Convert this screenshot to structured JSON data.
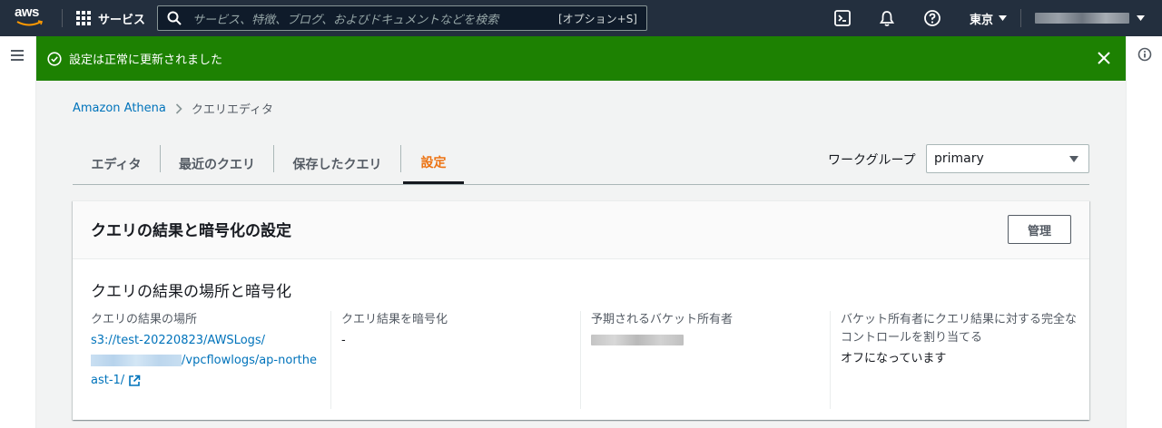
{
  "nav": {
    "logo_text": "aws",
    "services_label": "サービス",
    "search_placeholder": "サービス、特徴、ブログ、およびドキュメントなどを検索",
    "search_shortcut": "[オプション+S]",
    "region_label": "東京"
  },
  "flash": {
    "message": "設定は正常に更新されました"
  },
  "breadcrumb": {
    "root": "Amazon Athena",
    "current": "クエリエディタ"
  },
  "tabs": [
    {
      "label": "エディタ"
    },
    {
      "label": "最近のクエリ"
    },
    {
      "label": "保存したクエリ"
    },
    {
      "label": "設定"
    }
  ],
  "workgroup": {
    "label": "ワークグループ",
    "value": "primary"
  },
  "panel": {
    "title": "クエリの結果と暗号化の設定",
    "manage_label": "管理",
    "subtitle": "クエリの結果の場所と暗号化",
    "columns": {
      "location": {
        "label": "クエリの結果の場所",
        "value_prefix": "s3://test-20220823/AWSLogs/",
        "value_suffix": "/vpcflowlogs/ap-northeast-1/"
      },
      "encrypt": {
        "label": "クエリ結果を暗号化",
        "value": "-"
      },
      "owner": {
        "label": "予期されるバケット所有者"
      },
      "control": {
        "label": "バケット所有者にクエリ結果に対する完全なコントロールを割り当てる",
        "value": "オフになっています"
      }
    }
  },
  "colors": {
    "nav_bg": "#232f3e",
    "success": "#1d8102",
    "link": "#0073bb",
    "accent": "#ec7211"
  }
}
